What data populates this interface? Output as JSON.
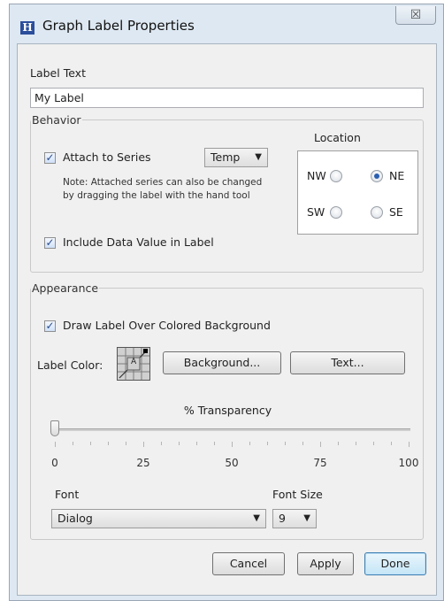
{
  "window": {
    "title": "Graph Label Properties",
    "close_glyph": "☒"
  },
  "label_text": {
    "heading": "Label Text",
    "value": "My Label"
  },
  "behavior": {
    "legend": "Behavior",
    "attach_to_series": {
      "label": "Attach to Series",
      "checked": true
    },
    "series_select": "Temp",
    "note_line1": "Note: Attached series can also be changed",
    "note_line2": "by dragging the label with the hand tool",
    "include_value": {
      "label": "Include Data Value in Label",
      "checked": true
    },
    "location": {
      "heading": "Location",
      "options": [
        {
          "label": "NW",
          "selected": false
        },
        {
          "label": "NE",
          "selected": true
        },
        {
          "label": "SW",
          "selected": false
        },
        {
          "label": "SE",
          "selected": false
        }
      ]
    }
  },
  "appearance": {
    "legend": "Appearance",
    "draw_background": {
      "label": "Draw Label Over Colored Background",
      "checked": true
    },
    "label_color": "Label Color:",
    "swatch_letter": "A",
    "background_button": "Background...",
    "text_button": "Text...",
    "transparency": {
      "heading": "% Transparency",
      "value": 0,
      "min": 0,
      "max": 100,
      "tick_labels": [
        "0",
        "25",
        "50",
        "75",
        "100"
      ]
    },
    "font": {
      "heading": "Font",
      "value": "Dialog"
    },
    "font_size": {
      "heading": "Font Size",
      "value": "9"
    }
  },
  "footer": {
    "cancel": "Cancel",
    "apply": "Apply",
    "done": "Done"
  },
  "icons": {
    "app": "graph-app-icon",
    "close": "close-icon",
    "dropdown": "chevron-down-icon"
  }
}
